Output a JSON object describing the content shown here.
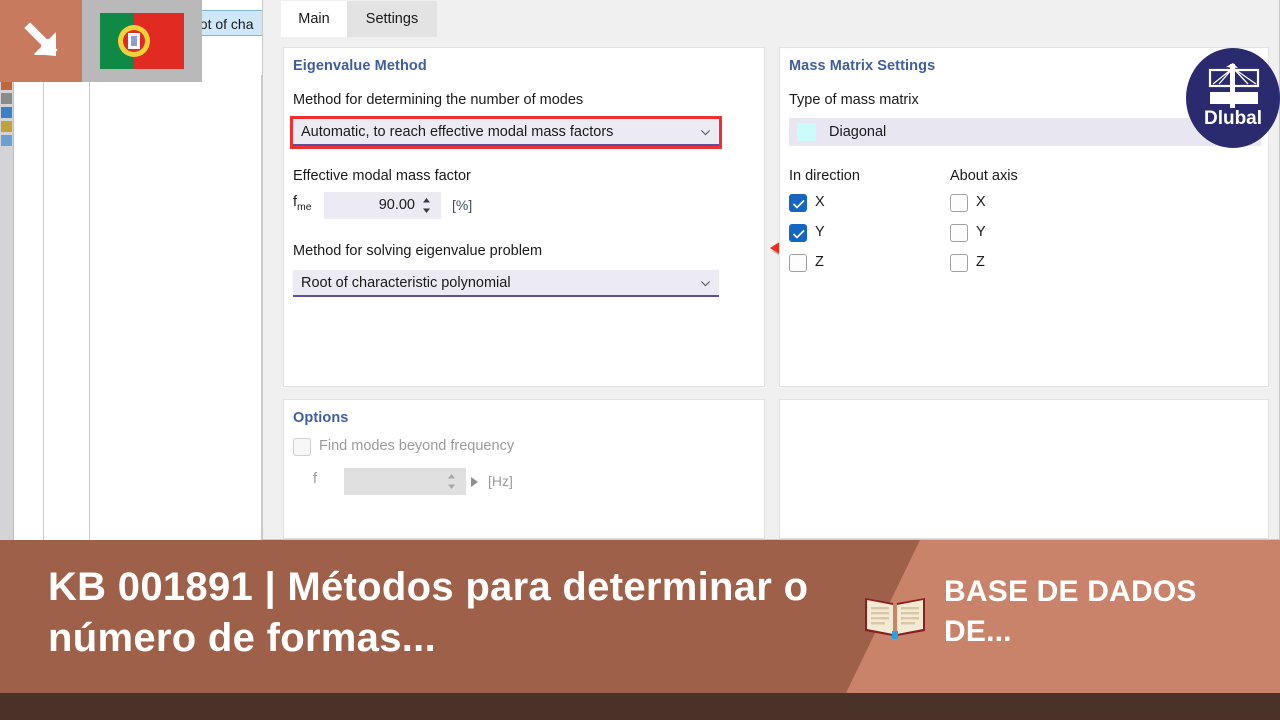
{
  "dialog": {
    "tabs": [
      {
        "id": "main",
        "label": "Main",
        "active": true
      },
      {
        "id": "settings",
        "label": "Settings",
        "active": false
      }
    ],
    "groups": {
      "eigenvalue": {
        "title": "Eigenvalue Method",
        "method_modes_label": "Method for determining the number of modes",
        "method_modes_value": "Automatic, to reach effective modal mass factors",
        "method_modes_highlight_color": "#f03030",
        "effective_mass_label": "Effective modal mass factor",
        "effective_mass_symbol": "f",
        "effective_mass_symbol_sub": "me",
        "effective_mass_value": "90.00",
        "effective_mass_unit": "[%]",
        "solve_method_label": "Method for solving eigenvalue problem",
        "solve_method_value": "Root of characteristic polynomial"
      },
      "mass_matrix": {
        "title": "Mass Matrix Settings",
        "type_label": "Type of mass matrix",
        "type_value": "Diagonal",
        "type_swatch_color": "#ccfbfb",
        "in_direction_header": "In direction",
        "about_axis_header": "About axis",
        "in_direction": [
          {
            "label": "X",
            "checked": true
          },
          {
            "label": "Y",
            "checked": true
          },
          {
            "label": "Z",
            "checked": false
          }
        ],
        "about_axis": [
          {
            "label": "X",
            "checked": false
          },
          {
            "label": "Y",
            "checked": false
          },
          {
            "label": "Z",
            "checked": false
          }
        ]
      },
      "options": {
        "title": "Options",
        "find_modes_label": "Find modes beyond frequency",
        "find_modes_checked": false,
        "frequency_symbol": "f",
        "frequency_value": "",
        "frequency_unit": "[Hz]"
      }
    }
  },
  "background": {
    "occluded_option_text": "oot of cha"
  },
  "logo": {
    "text": "Dlubal",
    "circle_color": "#2a2a6e"
  },
  "banner": {
    "title": "KB 001891 | Métodos para determinar o número de formas...",
    "right_title": "BASE DE DADOS DE...",
    "left_color": "#9e6049",
    "right_color": "#c9836a",
    "foot_color": "#4a3228"
  }
}
